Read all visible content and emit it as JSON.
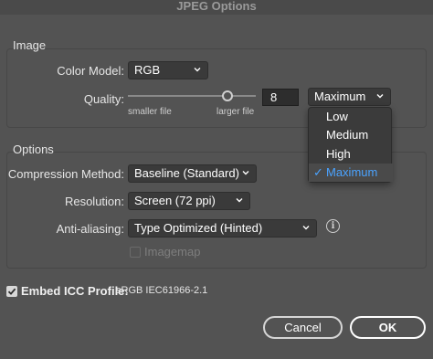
{
  "window": {
    "title": "JPEG Options"
  },
  "image_group": {
    "title": "Image",
    "color_model": {
      "label": "Color Model:",
      "value": "RGB"
    },
    "quality": {
      "label": "Quality:",
      "min_label": "smaller file",
      "max_label": "larger file",
      "value": "8",
      "slider_value": 8,
      "preset": "Maximum"
    }
  },
  "quality_menu": {
    "items": [
      {
        "label": "Low",
        "selected": false
      },
      {
        "label": "Medium",
        "selected": false
      },
      {
        "label": "High",
        "selected": false
      },
      {
        "label": "Maximum",
        "selected": true
      }
    ]
  },
  "options_group": {
    "title": "Options",
    "compression": {
      "label": "Compression Method:",
      "value": "Baseline (Standard)"
    },
    "resolution": {
      "label": "Resolution:",
      "value": "Screen (72 ppi)"
    },
    "antialiasing": {
      "label": "Anti-aliasing:",
      "value": "Type Optimized (Hinted)"
    },
    "imagemap": {
      "label": "Imagemap",
      "checked": false,
      "enabled": false
    }
  },
  "icc": {
    "label": "Embed ICC Profile:",
    "profile": "sRGB IEC61966-2.1",
    "checked": true
  },
  "buttons": {
    "cancel": "Cancel",
    "ok": "OK"
  },
  "colors": {
    "background": "#535353",
    "menu_selected": "#4aa3ff"
  }
}
